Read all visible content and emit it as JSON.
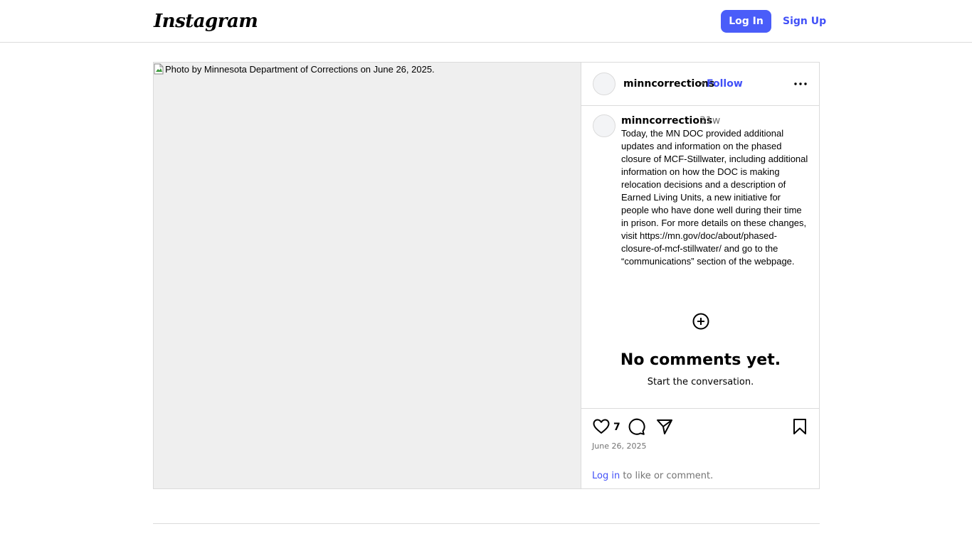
{
  "header": {
    "logo_text": "Instagram",
    "login_label": "Log In",
    "signup_label": "Sign Up"
  },
  "media": {
    "alt_text": "Photo by Minnesota Department of Corrections on June 26, 2025."
  },
  "post_header": {
    "username": "minncorrections",
    "separator": "•",
    "follow_label": "Follow",
    "more_icon": "more-horizontal-icon"
  },
  "caption": {
    "username": "minncorrections",
    "time_ago": "31w",
    "text": "Today, the MN DOC provided additional updates and information on the phased closure of MCF-Stillwater, including additional information on how the DOC is making relocation decisions and a description of Earned Living Units, a new initiative for people who have done well during their time in prison. For more details on these changes, visit https://mn.gov/doc/about/phased-closure-of-mcf-stillwater/ and go to the “communications” section of the webpage."
  },
  "comments": {
    "empty_title": "No comments yet.",
    "empty_subtitle": "Start the conversation."
  },
  "actions": {
    "like_count": "7",
    "date": "June 26, 2025",
    "login_link": "Log in",
    "login_suffix": " to like or comment."
  },
  "colors": {
    "accent": "#4a5df9",
    "link": "#4150f7",
    "border": "#dbdbdb",
    "media_bg": "#efefef",
    "muted_text": "#737373"
  }
}
